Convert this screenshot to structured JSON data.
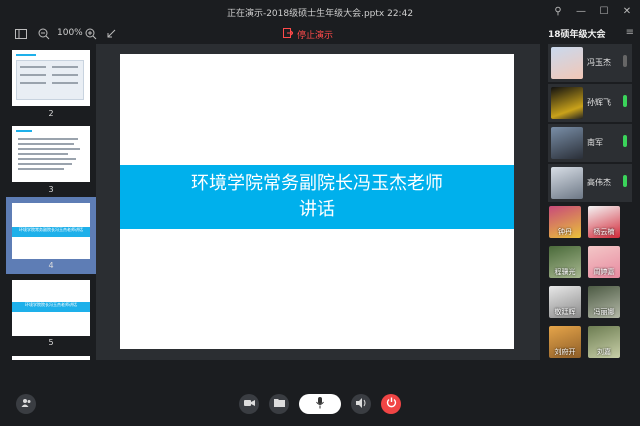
{
  "window": {
    "title": "正在演示-2018级硕士生年级大会.pptx 22:42"
  },
  "toolbar": {
    "zoom_value": "100%",
    "stop_label": "停止演示"
  },
  "thumbnails": [
    {
      "number": "2"
    },
    {
      "number": "3"
    },
    {
      "number": "4",
      "band_text": "环境学院常务副院长冯玉杰老师讲话"
    },
    {
      "number": "5",
      "band_text": "环境学院院长冯玉杰老师讲话"
    }
  ],
  "slide": {
    "title_line1": "环境学院常务副院长冯玉杰老师",
    "title_line2": "讲话"
  },
  "participants": {
    "title": "18硕年级大会",
    "main": [
      {
        "name": "冯玉杰",
        "mic": "off"
      },
      {
        "name": "孙辉飞",
        "mic": "on"
      },
      {
        "name": "南军",
        "mic": "on"
      },
      {
        "name": "高伟杰",
        "mic": "on"
      }
    ],
    "others": [
      {
        "name": "钟丹"
      },
      {
        "name": "杨云楠"
      },
      {
        "name": "程骥光"
      },
      {
        "name": "周婷嘉"
      },
      {
        "name": "敬廷辉"
      },
      {
        "name": "冯丽娜"
      },
      {
        "name": "刘府开"
      },
      {
        "name": "刘嘉"
      }
    ]
  },
  "colors": {
    "band": "#00b0ec",
    "stop": "#ff4a4a",
    "mic_on": "#3ad35a",
    "power": "#f04545"
  }
}
